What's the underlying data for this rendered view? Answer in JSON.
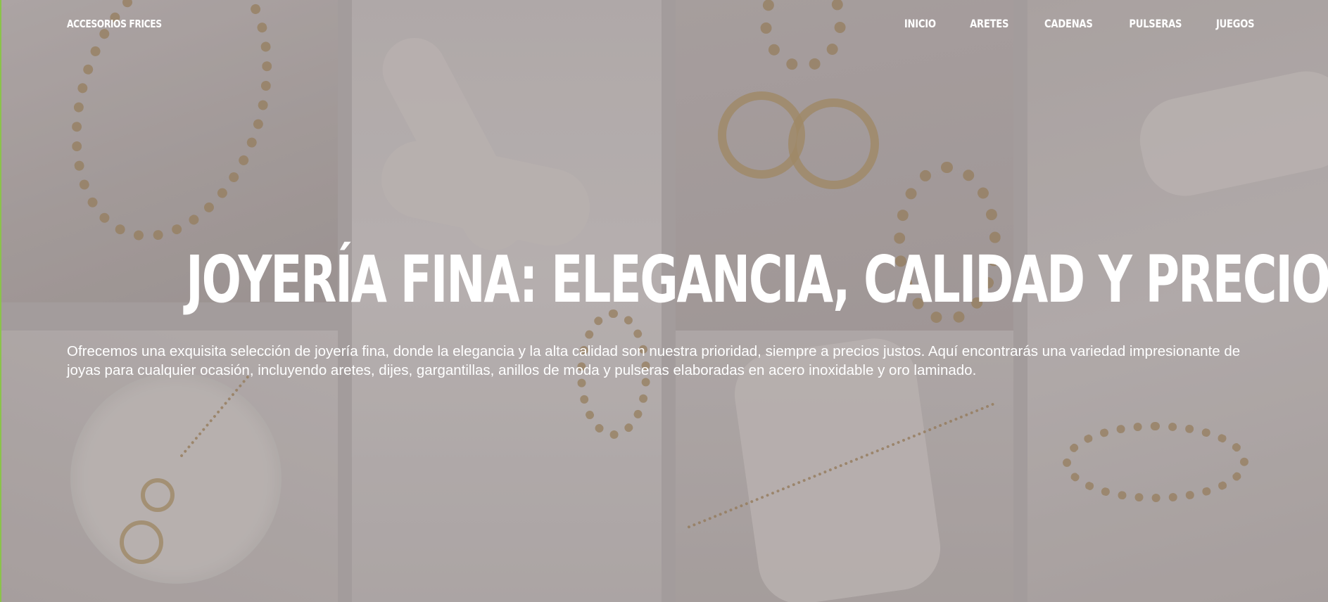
{
  "header": {
    "logo": "ACCESORIOS FRICES",
    "nav": [
      {
        "label": "INICIO"
      },
      {
        "label": "ARETES"
      },
      {
        "label": "CADENAS"
      },
      {
        "label": "PULSERAS"
      },
      {
        "label": "JUEGOS"
      }
    ]
  },
  "hero": {
    "title": "JOYERÍA FINA: ELEGANCIA, CALIDAD Y PRECIO JUSTO",
    "description": "Ofrecemos una exquisita selección de joyería fina, donde la elegancia y la alta calidad son nuestra prioridad, siempre a precios justos. Aquí encontrarás una variedad impresionante de joyas para cualquier ocasión, incluyendo aretes, dijes, gargantillas, anillos de moda y pulseras elaboradas en acero inoxidable y oro laminado."
  },
  "colors": {
    "text": "#ffffff",
    "overlay": "#3c373a",
    "accent_edge": "#8bc34a",
    "gold": "#c4a877"
  }
}
